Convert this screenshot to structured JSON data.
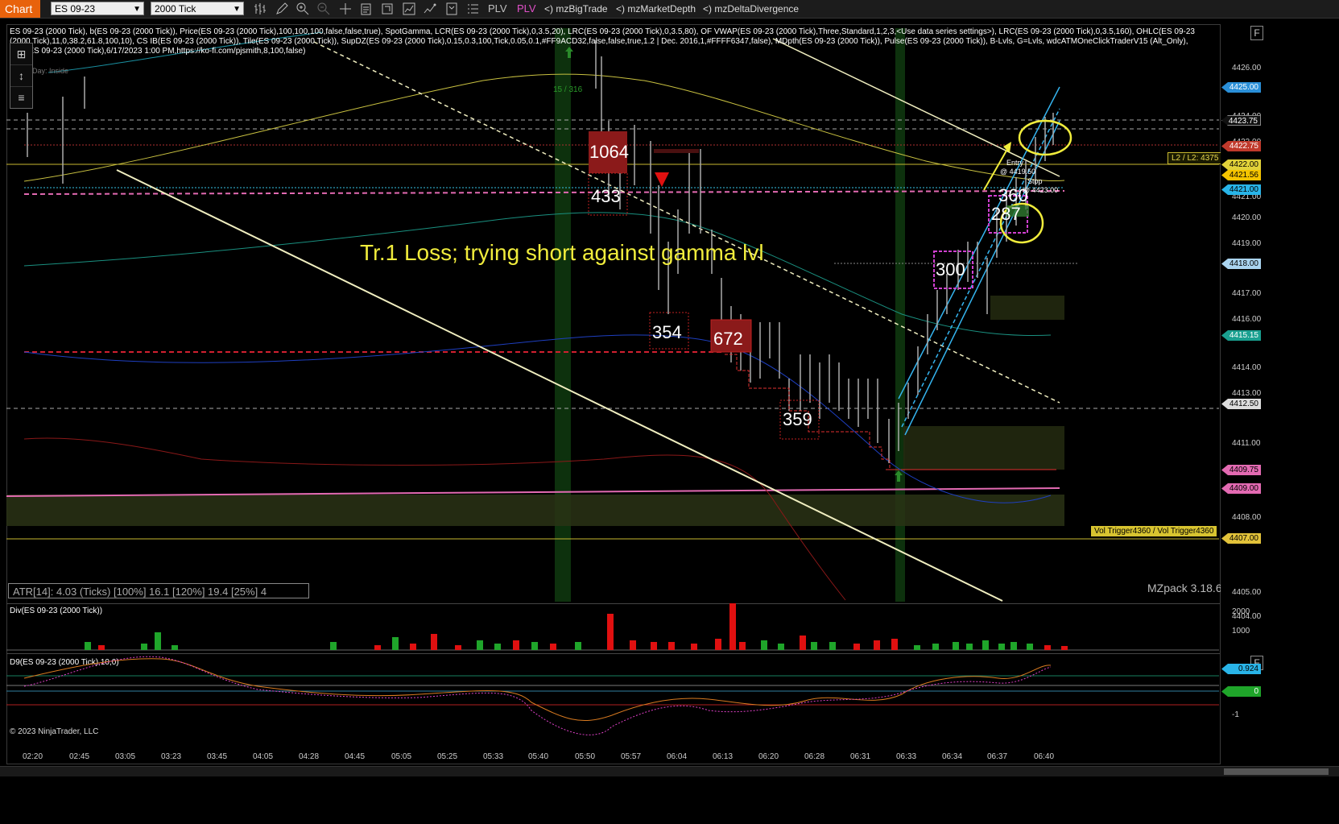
{
  "toolbar": {
    "chart_tab": "Chart",
    "instrument": "ES 09-23",
    "period": "2000 Tick",
    "plv1": "PLV",
    "plv2": "PLV",
    "plugins": [
      "<) mzBigTrade",
      "<) mzMarketDepth",
      "<) mzDeltaDivergence"
    ]
  },
  "indicator_text": "ES 09-23 (2000 Tick), b(ES 09-23 (2000 Tick)), Price(ES 09-23 (2000 Tick),100,100,100,false,false,true), SpotGamma, LCR(ES 09-23 (2000 Tick),0,3.5,20), LRC(ES 09-23 (2000 Tick),0,3.5,80), OF VWAP(ES 09-23 (2000 Tick),Three,Standard,1,2,3,<Use data series settings>), LRC(ES 09-23 (2000 Tick),0,3.5,160), OHLC(ES 09-23 (2000 Tick),11,0,38.2,61.8,100,10), CS IB(ES 09-23 (2000 Tick)), Tile(ES 09-23 (2000 Tick)), SupDZ(ES 09-23 (2000 Tick),0.15,0.3,100,Tick,0.05,0.1,#FF9ACD32,false,false,true,1.2 | Dec. 2016,1,#FFFF6347,false), MDpth(ES 09-23 (2000 Tick)), Pulse(ES 09-23 (2000 Tick)), B-Lvls, G=Lvls, wdcATMOneClickTraderV15 (Alt_Only), pjsR(ES 09-23 (2000 Tick),6/17/2023 1:00 PM,https://ko-fi.com/pjsmith,8,100,false)",
  "day_label": "Day: Inside",
  "annotation": "Tr.1 Loss; trying short against gamma lvl",
  "bar_count_label": "15 / 316",
  "big_trades": [
    "1064",
    "433",
    "354",
    "672",
    "359",
    "300",
    "287",
    "360"
  ],
  "entry_label": "Entry",
  "entry_price": "@ 4419.50",
  "stop_label": "Stop",
  "stop_price": "@ 4423.00",
  "level_labels": {
    "l2": "L2 / L2: 4375",
    "vol_trigger": "Vol Trigger4360 / Vol Trigger4360"
  },
  "atr_text": "ATR[14]: 4.03 (Ticks) [100%] 16.1  [120%] 19.4  [25%] 4",
  "mzpack": "MZpack 3.18.6",
  "div_panel_label": "Div(ES 09-23 (2000 Tick))",
  "d9_panel_label": "D9(ES 09-23 (2000 Tick),10,0)",
  "copyright": "© 2023 NinjaTrader, LLC",
  "price_ticks": [
    "4426.00",
    "4424.00",
    "4423.00",
    "4421.00",
    "4420.00",
    "4419.00",
    "4417.00",
    "4416.00",
    "4414.00",
    "4413.00",
    "4411.00",
    "4410.00",
    "4408.00",
    "4405.00",
    "4404.00"
  ],
  "price_tags": [
    {
      "text": "4425.00",
      "color": "#2a8fd8",
      "fg": "#fff"
    },
    {
      "text": "4423.75",
      "color": "#111",
      "fg": "#fff"
    },
    {
      "text": "4422.75",
      "color": "#c0392b",
      "fg": "#fff"
    },
    {
      "text": "4422.00",
      "color": "#e2d23a",
      "fg": "#000"
    },
    {
      "text": "4421.56",
      "color": "#f5c400",
      "fg": "#000"
    },
    {
      "text": "4421.00",
      "color": "#28b4e8",
      "fg": "#000"
    },
    {
      "text": "4418.00",
      "color": "#aad4f0",
      "fg": "#000"
    },
    {
      "text": "4415.15",
      "color": "#1aa090",
      "fg": "#fff"
    },
    {
      "text": "4412.50",
      "color": "#ddd",
      "fg": "#000"
    },
    {
      "text": "4409.75",
      "color": "#e36ab2",
      "fg": "#000"
    },
    {
      "text": "4409.00",
      "color": "#e36ab2",
      "fg": "#000"
    },
    {
      "text": "4407.00",
      "color": "#e2c23a",
      "fg": "#000"
    }
  ],
  "div_ticks": [
    "2000",
    "1000"
  ],
  "d9_ticks": [
    "0.924",
    "0",
    "-1"
  ],
  "time_ticks": [
    "02:20",
    "02:45",
    "03:05",
    "03:23",
    "03:45",
    "04:05",
    "04:28",
    "04:45",
    "05:05",
    "05:25",
    "05:33",
    "05:40",
    "05:50",
    "05:57",
    "06:04",
    "06:13",
    "06:20",
    "06:28",
    "06:31",
    "06:33",
    "06:34",
    "06:37",
    "06:40"
  ],
  "colors": {
    "annotation": "#f0ec3c",
    "up_volume": "#1fa52a",
    "down_volume": "#e01010",
    "channel": "#35b5f0",
    "vwap": "#c8c040"
  }
}
